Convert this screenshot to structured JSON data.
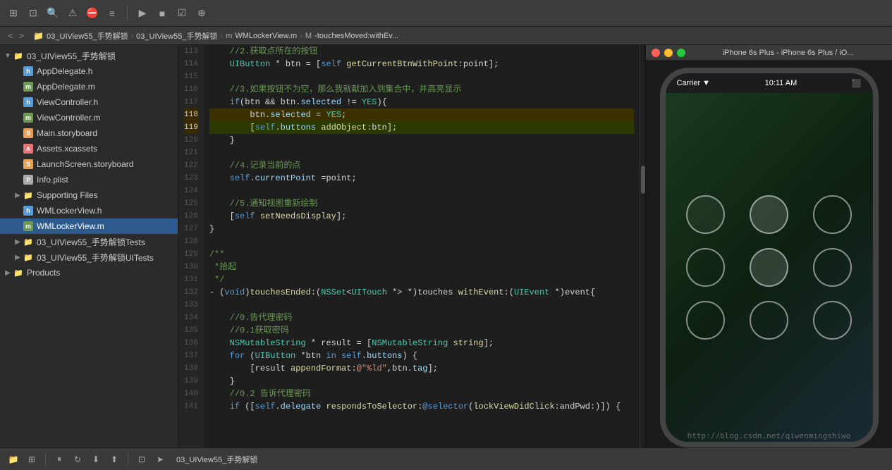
{
  "toolbar": {
    "icons": [
      "new-file",
      "new-folder",
      "search",
      "warning",
      "error",
      "list",
      "run",
      "stop",
      "scheme"
    ]
  },
  "breadcrumb": {
    "back": "<",
    "forward": ">",
    "items": [
      "03_UIView55_手势解锁",
      "03_UIView55_手势解锁",
      "WMLockerView.m",
      "-touchesMoved:withEv..."
    ]
  },
  "sidebar": {
    "project_root": "03_UIView55_手势解锁",
    "items": [
      {
        "id": "root-group",
        "label": "03_UIView55_手势解锁",
        "indent": 0,
        "type": "group",
        "expanded": true
      },
      {
        "id": "AppDelegate-h",
        "label": "AppDelegate.h",
        "indent": 2,
        "type": "h"
      },
      {
        "id": "AppDelegate-m",
        "label": "AppDelegate.m",
        "indent": 2,
        "type": "m"
      },
      {
        "id": "ViewController-h",
        "label": "ViewController.h",
        "indent": 2,
        "type": "h"
      },
      {
        "id": "ViewController-m",
        "label": "ViewController.m",
        "indent": 2,
        "type": "m"
      },
      {
        "id": "Main-storyboard",
        "label": "Main.storyboard",
        "indent": 2,
        "type": "storyboard"
      },
      {
        "id": "Assets-xcassets",
        "label": "Assets.xcassets",
        "indent": 2,
        "type": "xcassets"
      },
      {
        "id": "LaunchScreen-storyboard",
        "label": "LaunchScreen.storyboard",
        "indent": 2,
        "type": "storyboard"
      },
      {
        "id": "Info-plist",
        "label": "Info.plist",
        "indent": 2,
        "type": "plist"
      },
      {
        "id": "Supporting-Files",
        "label": "Supporting Files",
        "indent": 1,
        "type": "folder",
        "expanded": false
      },
      {
        "id": "WMLockerView-h",
        "label": "WMLockerView.h",
        "indent": 2,
        "type": "h"
      },
      {
        "id": "WMLockerView-m",
        "label": "WMLockerView.m",
        "indent": 2,
        "type": "m",
        "selected": true
      },
      {
        "id": "Tests-group",
        "label": "03_UIView55_手势解锁Tests",
        "indent": 1,
        "type": "group"
      },
      {
        "id": "UITests-group",
        "label": "03_UIView55_手势解锁UITests",
        "indent": 1,
        "type": "group"
      },
      {
        "id": "Products",
        "label": "Products",
        "indent": 0,
        "type": "folder"
      }
    ]
  },
  "code": {
    "lines": [
      {
        "num": 113,
        "content": "    //2.获取点所在的按钮",
        "type": "comment"
      },
      {
        "num": 114,
        "content": "    UIButton * btn = [self getCurrentBtnWithPoint:point];",
        "type": "code"
      },
      {
        "num": 115,
        "content": "",
        "type": "empty"
      },
      {
        "num": 116,
        "content": "    //3.如果按钮不为空，那么我就献加入到集合中，并高亮显示",
        "type": "comment"
      },
      {
        "num": 117,
        "content": "    if(btn && btn.selected != YES){",
        "type": "code"
      },
      {
        "num": 118,
        "content": "        btn.selected = YES;",
        "type": "code",
        "highlight": true
      },
      {
        "num": 119,
        "content": "        [self.buttons addObject:btn];",
        "type": "code",
        "highlight2": true
      },
      {
        "num": 120,
        "content": "    }",
        "type": "code"
      },
      {
        "num": 121,
        "content": "",
        "type": "empty"
      },
      {
        "num": 122,
        "content": "    //4.记录当前的点",
        "type": "comment"
      },
      {
        "num": 123,
        "content": "    self.currentPoint =point;",
        "type": "code"
      },
      {
        "num": 124,
        "content": "",
        "type": "empty"
      },
      {
        "num": 125,
        "content": "    //5.通知视图重新绘制",
        "type": "comment"
      },
      {
        "num": 126,
        "content": "    [self setNeedsDisplay];",
        "type": "code"
      },
      {
        "num": 127,
        "content": "}",
        "type": "code"
      },
      {
        "num": 128,
        "content": "",
        "type": "empty"
      },
      {
        "num": 129,
        "content": "/**",
        "type": "comment"
      },
      {
        "num": 130,
        "content": " *拾起",
        "type": "comment"
      },
      {
        "num": 131,
        "content": " */",
        "type": "comment"
      },
      {
        "num": 132,
        "content": "- (void)touchesEnded:(NSSet<UITouch *> *)touches withEvent:(UIEvent *)event{",
        "type": "code"
      },
      {
        "num": 133,
        "content": "",
        "type": "empty"
      },
      {
        "num": 134,
        "content": "    //0.告代理密码",
        "type": "comment"
      },
      {
        "num": 135,
        "content": "    //0.1获取密码",
        "type": "comment"
      },
      {
        "num": 136,
        "content": "    NSMutableString * result = [NSMutableString string];",
        "type": "code"
      },
      {
        "num": 137,
        "content": "    for (UIButton *btn in self.buttons) {",
        "type": "code"
      },
      {
        "num": 138,
        "content": "        [result appendFormat:@\"%ld\",btn.tag];",
        "type": "code"
      },
      {
        "num": 139,
        "content": "    }",
        "type": "code"
      },
      {
        "num": 140,
        "content": "    //0.2 告诉代理密码",
        "type": "comment"
      },
      {
        "num": 141,
        "content": "    if ([self.delegate respondsToSelector:@selector(lockViewDidClick:andPwd:)]) {",
        "type": "code"
      }
    ]
  },
  "simulator": {
    "title": "iPhone 6s Plus - iPhone 6s Plus / iO...",
    "status_time": "10:11 AM",
    "carrier": "Carrier ▼",
    "buttons": {
      "close": "●",
      "minimize": "●",
      "maximize": "●"
    }
  },
  "bottom_toolbar": {
    "project_name": "03_UIView55_手势解锁"
  },
  "watermark": "http://blog.csdn.net/qiwenmingshiwo"
}
